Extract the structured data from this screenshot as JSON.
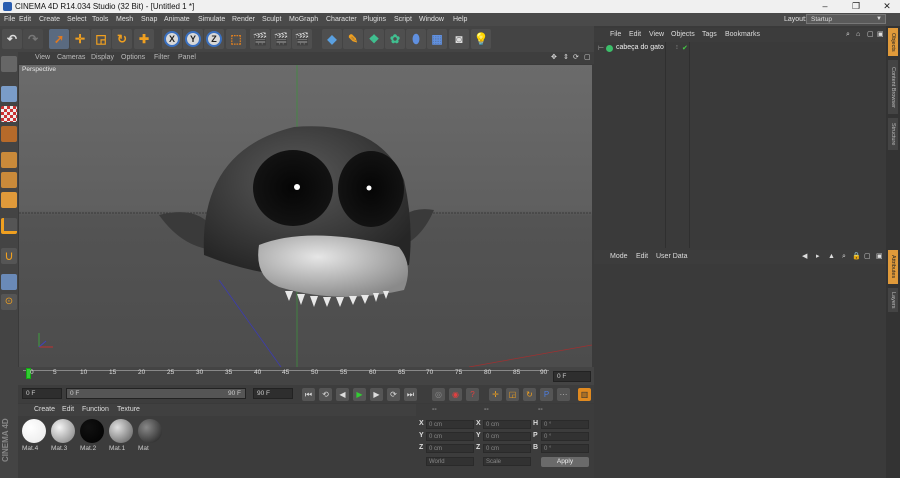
{
  "window": {
    "title": "CINEMA 4D R14.034 Studio (32 Bit) - [Untitled 1 *]",
    "controls": [
      "–",
      "❐",
      "✕"
    ]
  },
  "menubar": {
    "items": [
      "File",
      "Edit",
      "Create",
      "Select",
      "Tools",
      "Mesh",
      "Snap",
      "Animate",
      "Simulate",
      "Render",
      "Sculpt",
      "MoGraph",
      "Character",
      "Plugins",
      "Script",
      "Window",
      "Help"
    ],
    "layout_label": "Layout:",
    "layout_value": "Startup"
  },
  "toolbar": {
    "axis_x": "X",
    "axis_y": "Y",
    "axis_z": "Z",
    "icons": [
      "undo-icon",
      "redo-icon",
      "live-selection-icon",
      "move-icon",
      "scale-icon",
      "rotate-icon",
      "last-tool-icon",
      "x-axis-lock-icon",
      "y-axis-lock-icon",
      "z-axis-lock-icon",
      "coordinate-system-icon",
      "render-view-icon",
      "render-picture-viewer-icon",
      "render-settings-icon",
      "cube-icon",
      "nurbs-icon",
      "array-icon",
      "deformer-icon",
      "scene-icon",
      "floor-icon",
      "camera-icon",
      "light-icon"
    ]
  },
  "viewport": {
    "menu": [
      "View",
      "Cameras",
      "Display",
      "Options",
      "Filter",
      "Panel"
    ],
    "label": "Perspective"
  },
  "timeline": {
    "ticks": [
      "0",
      "5",
      "10",
      "15",
      "20",
      "25",
      "30",
      "35",
      "40",
      "45",
      "50",
      "55",
      "60",
      "65",
      "70",
      "75",
      "80",
      "85",
      "90"
    ],
    "current_frame": "0 F"
  },
  "transport": {
    "start": "0 F",
    "range_start": "0 F",
    "range_end": "90 F",
    "end": "90 F"
  },
  "materials": {
    "menu": [
      "Create",
      "Edit",
      "Function",
      "Texture"
    ],
    "items": [
      {
        "label": "Mat.4",
        "color": "#ffffff"
      },
      {
        "label": "Mat.3",
        "color": "#d0d0d0"
      },
      {
        "label": "Mat.2",
        "color": "#000000"
      },
      {
        "label": "Mat.1",
        "color": "#a8a8a8"
      },
      {
        "label": "Mat",
        "color": "#3a3a3a"
      }
    ],
    "side_label": "CINEMA 4D"
  },
  "coordinates": {
    "header": [
      "--",
      "--",
      "--"
    ],
    "rows": [
      {
        "a": "X",
        "av": "0 cm",
        "b": "X",
        "bv": "0 cm",
        "c": "H",
        "cv": "0 °"
      },
      {
        "a": "Y",
        "av": "0 cm",
        "b": "Y",
        "bv": "0 cm",
        "c": "P",
        "cv": "0 °"
      },
      {
        "a": "Z",
        "av": "0 cm",
        "b": "Z",
        "bv": "0 cm",
        "c": "B",
        "cv": "0 °"
      }
    ],
    "mode": "World",
    "size_mode": "Scale",
    "apply": "Apply"
  },
  "objects": {
    "menu": [
      "File",
      "Edit",
      "View",
      "Objects",
      "Tags",
      "Bookmarks"
    ],
    "items": [
      {
        "name": "cabeça do gato"
      }
    ]
  },
  "attributes": {
    "menu": [
      "Mode",
      "Edit",
      "User Data"
    ]
  },
  "sidetabs": [
    "Objects",
    "Content Browser",
    "Structure",
    "Attributes",
    "Layers"
  ]
}
